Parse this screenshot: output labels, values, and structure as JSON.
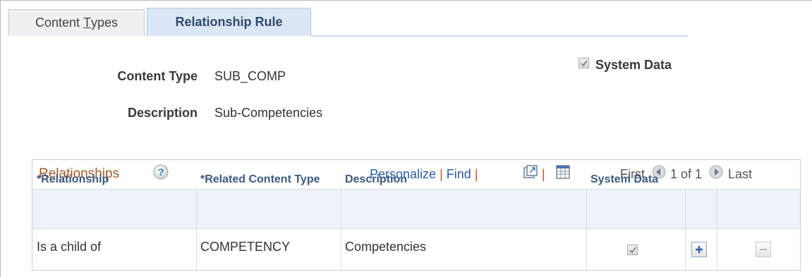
{
  "tabs": [
    {
      "label_prefix": "Content ",
      "label_underlined": "T",
      "label_suffix": "ypes",
      "active": false
    },
    {
      "label": "Relationship Rule",
      "active": true
    }
  ],
  "header": {
    "system_data_label": "System Data",
    "system_data_checked": true
  },
  "fields": {
    "content_type_label": "Content Type",
    "content_type_value": "SUB_COMP",
    "description_label": "Description",
    "description_value": "Sub-Competencies"
  },
  "grid": {
    "title": "Relationships",
    "help_icon": "help-icon",
    "personalize_label": "Personalize",
    "find_label": "Find",
    "separator": "|",
    "zoom_icon": "zoom-icon",
    "download_icon": "download-icon",
    "first_label": "First",
    "range_label": "1 of 1",
    "last_label": "Last",
    "columns": {
      "relationship": "*Relationship",
      "related_content_type": "*Related Content Type",
      "description": "Description",
      "system_data": "System Data"
    },
    "rows": [
      {
        "relationship": "Is a child of",
        "related_content_type": "COMPETENCY",
        "description": "Competencies",
        "system_data": true
      }
    ],
    "add_icon": "plus-icon",
    "delete_icon": "minus-icon"
  },
  "colors": {
    "accent_link": "#2a5ea8",
    "grid_title": "#a25a2b",
    "header_bg": "#eef3f9",
    "separator": "#cc4e24"
  }
}
